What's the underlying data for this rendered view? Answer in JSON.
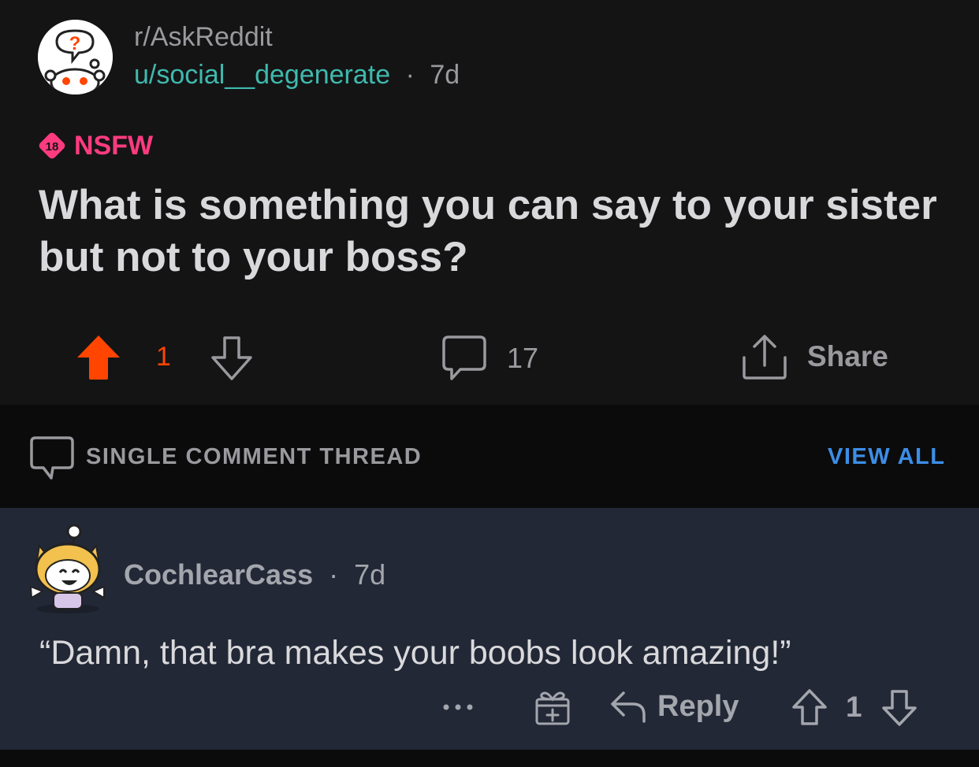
{
  "post": {
    "subreddit": "r/AskReddit",
    "author": "u/social__degenerate",
    "separator": "·",
    "age": "7d",
    "nsfw_badge": "18",
    "nsfw_label": "NSFW",
    "title": "What is something you can say to your sister but not to your boss?",
    "vote_count": "1",
    "comment_count": "17",
    "share_label": "Share"
  },
  "thread_bar": {
    "label": "SINGLE COMMENT THREAD",
    "view_all": "VIEW ALL"
  },
  "comment": {
    "author": "CochlearCass",
    "separator": "·",
    "age": "7d",
    "body": "“Damn, that bra makes your boobs look amazing!”",
    "reply_label": "Reply",
    "vote_count": "1"
  },
  "icons": {
    "upvote": "upvote-arrow-icon",
    "downvote": "downvote-arrow-icon",
    "comment": "speech-bubble-icon",
    "share": "share-upload-icon",
    "more": "more-dots-icon",
    "award": "gift-icon",
    "reply": "reply-arrow-icon"
  },
  "colors": {
    "upvote_active": "#ff4500",
    "nsfw": "#ff3b7f",
    "username_link": "#3fb9ad",
    "view_all": "#3c8ee6",
    "post_bg": "#141415",
    "comment_bg": "#222836",
    "text_muted": "#9a9a9e",
    "text_primary": "#d9d9dc"
  }
}
